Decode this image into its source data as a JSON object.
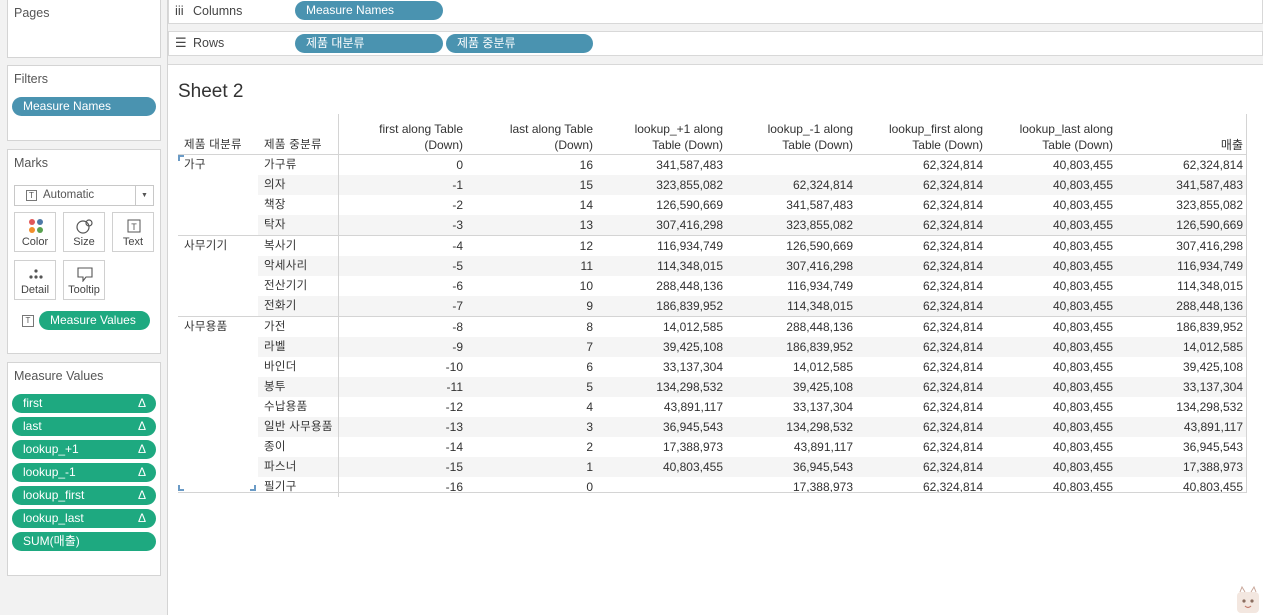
{
  "pages": {
    "title": "Pages"
  },
  "filters": {
    "title": "Filters",
    "pills": [
      "Measure Names"
    ]
  },
  "marks": {
    "title": "Marks",
    "type": "Automatic",
    "buttons": {
      "color": "Color",
      "size": "Size",
      "text": "Text",
      "detail": "Detail",
      "tooltip": "Tooltip"
    },
    "text_pill": "Measure Values"
  },
  "measure_values": {
    "title": "Measure Values",
    "pills": [
      "first",
      "last",
      "lookup_+1",
      "lookup_-1",
      "lookup_first",
      "lookup_last",
      "SUM(매출)"
    ],
    "delta": "Δ"
  },
  "shelves": {
    "columns": {
      "label": "Columns",
      "pills": [
        "Measure Names"
      ]
    },
    "rows": {
      "label": "Rows",
      "pills": [
        "제품 대분류",
        "제품 중분류"
      ]
    }
  },
  "sheet": {
    "title": "Sheet 2",
    "dim_headers": [
      "제품 대분류",
      "제품 중분류"
    ],
    "measure_headers": [
      [
        "first along Table",
        "(Down)"
      ],
      [
        "last along Table",
        "(Down)"
      ],
      [
        "lookup_+1 along",
        "Table (Down)"
      ],
      [
        "lookup_-1 along",
        "Table (Down)"
      ],
      [
        "lookup_first along",
        "Table (Down)"
      ],
      [
        "lookup_last along",
        "Table (Down)"
      ],
      [
        "",
        "매출"
      ]
    ],
    "groups": [
      {
        "name": "가구",
        "rows": [
          {
            "sub": "가구류",
            "v": [
              "0",
              "16",
              "341,587,483",
              "",
              "62,324,814",
              "40,803,455",
              "62,324,814"
            ]
          },
          {
            "sub": "의자",
            "v": [
              "-1",
              "15",
              "323,855,082",
              "62,324,814",
              "62,324,814",
              "40,803,455",
              "341,587,483"
            ]
          },
          {
            "sub": "책장",
            "v": [
              "-2",
              "14",
              "126,590,669",
              "341,587,483",
              "62,324,814",
              "40,803,455",
              "323,855,082"
            ]
          },
          {
            "sub": "탁자",
            "v": [
              "-3",
              "13",
              "307,416,298",
              "323,855,082",
              "62,324,814",
              "40,803,455",
              "126,590,669"
            ]
          }
        ]
      },
      {
        "name": "사무기기",
        "rows": [
          {
            "sub": "복사기",
            "v": [
              "-4",
              "12",
              "116,934,749",
              "126,590,669",
              "62,324,814",
              "40,803,455",
              "307,416,298"
            ]
          },
          {
            "sub": "악세사리",
            "v": [
              "-5",
              "11",
              "114,348,015",
              "307,416,298",
              "62,324,814",
              "40,803,455",
              "116,934,749"
            ]
          },
          {
            "sub": "전산기기",
            "v": [
              "-6",
              "10",
              "288,448,136",
              "116,934,749",
              "62,324,814",
              "40,803,455",
              "114,348,015"
            ]
          },
          {
            "sub": "전화기",
            "v": [
              "-7",
              "9",
              "186,839,952",
              "114,348,015",
              "62,324,814",
              "40,803,455",
              "288,448,136"
            ]
          }
        ]
      },
      {
        "name": "사무용품",
        "rows": [
          {
            "sub": "가전",
            "v": [
              "-8",
              "8",
              "14,012,585",
              "288,448,136",
              "62,324,814",
              "40,803,455",
              "186,839,952"
            ]
          },
          {
            "sub": "라벨",
            "v": [
              "-9",
              "7",
              "39,425,108",
              "186,839,952",
              "62,324,814",
              "40,803,455",
              "14,012,585"
            ]
          },
          {
            "sub": "바인더",
            "v": [
              "-10",
              "6",
              "33,137,304",
              "14,012,585",
              "62,324,814",
              "40,803,455",
              "39,425,108"
            ]
          },
          {
            "sub": "봉투",
            "v": [
              "-11",
              "5",
              "134,298,532",
              "39,425,108",
              "62,324,814",
              "40,803,455",
              "33,137,304"
            ]
          },
          {
            "sub": "수납용품",
            "v": [
              "-12",
              "4",
              "43,891,117",
              "33,137,304",
              "62,324,814",
              "40,803,455",
              "134,298,532"
            ]
          },
          {
            "sub": "일반 사무용품",
            "v": [
              "-13",
              "3",
              "36,945,543",
              "134,298,532",
              "62,324,814",
              "40,803,455",
              "43,891,117"
            ]
          },
          {
            "sub": "종이",
            "v": [
              "-14",
              "2",
              "17,388,973",
              "43,891,117",
              "62,324,814",
              "40,803,455",
              "36,945,543"
            ]
          },
          {
            "sub": "파스너",
            "v": [
              "-15",
              "1",
              "40,803,455",
              "36,945,543",
              "62,324,814",
              "40,803,455",
              "17,388,973"
            ]
          },
          {
            "sub": "필기구",
            "v": [
              "-16",
              "0",
              "",
              "17,388,973",
              "62,324,814",
              "40,803,455",
              "40,803,455"
            ]
          }
        ]
      }
    ]
  }
}
